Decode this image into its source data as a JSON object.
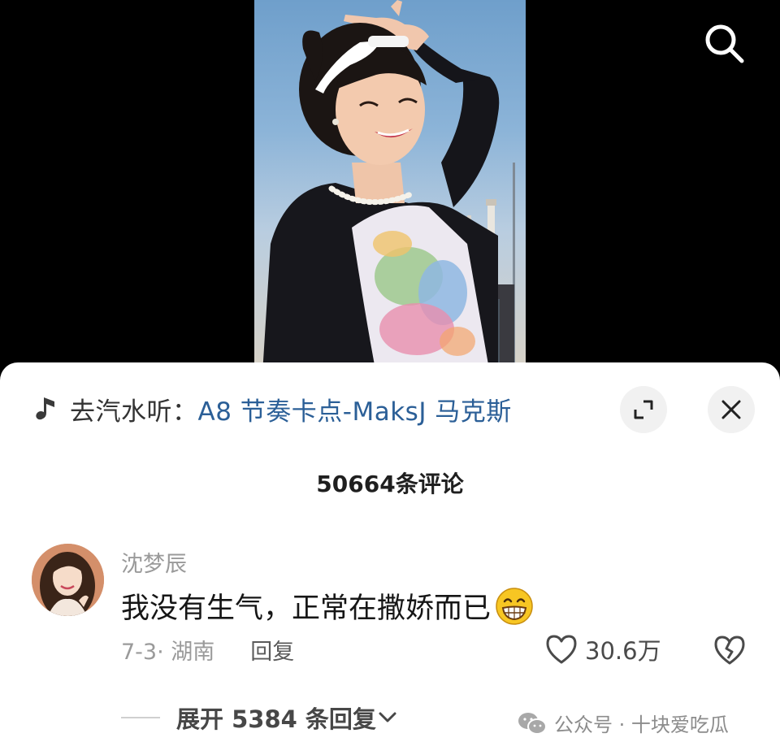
{
  "video": {
    "music_prefix": "去汽水听：",
    "music_title": "A8 节奏卡点-MaksJ 马克斯"
  },
  "icons": {
    "search": "search-icon",
    "music": "music-note-icon",
    "expand": "expand-icon",
    "close": "close-icon",
    "heart": "heart-icon",
    "broken_heart": "broken-heart-icon",
    "chevron": "chevron-down-icon",
    "wechat": "wechat-icon",
    "emoji": "grinning-emoji-icon"
  },
  "comments": {
    "count_label": "50664条评论",
    "items": [
      {
        "username": "沈梦辰",
        "text": "我没有生气，正常在撒娇而已",
        "date_location": "7-3· 湖南",
        "reply_label": "回复",
        "likes": "30.6万",
        "expand_replies": "展开 5384 条回复"
      }
    ]
  },
  "watermark": {
    "text": "公众号 · 十块爱吃瓜"
  },
  "colors": {
    "link": "#2b5f97",
    "sheet_background": "#ffffff",
    "muted_text": "#9a9a9a"
  }
}
